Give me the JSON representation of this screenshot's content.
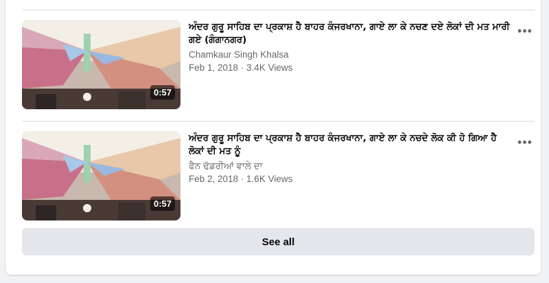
{
  "videos": [
    {
      "title": "ਅੰਦਰ ਗੁਰੂ ਸਾਹਿਬ ਦਾ ਪ੍ਰਕਾਸ਼ ਹੈ ਬਾਹਰ ਕੰਜਰਖਾਨਾ, ਗਾਏ ਲਾ ਕੇ ਨਚਣ ਦਏ ਲੋਕਾਂ ਦੀ ਮਤ ਮਾਰੀ ਗਏ (ਗੰਗਾਨਗਰ)",
      "channel": "Chamkaur Singh Khalsa",
      "stats": "Feb 1, 2018 · 3.4K Views",
      "duration": "0:57",
      "more_icon": "more-horizontal-icon"
    },
    {
      "title": "ਅੰਦਰ ਗੁਰੂ ਸਾਹਿਬ ਦਾ ਪ੍ਰਕਾਸ਼ ਹੈ ਬਾਹਰ ਕੰਜਰਖਾਨਾ, ਗਾਏ ਲਾ ਕੇ ਨਚਦੇ ਲੋਕ ਕੀ ਹੋ ਗਿਆ ਹੈ ਲੋਕਾਂ ਦੀ ਮਤ ਨੂੰ",
      "channel": "ਫੈਨ ਢੱਡਰੀਆਂ ਵਾਲੇ ਦਾ",
      "stats": "Feb 2, 2018 · 1.6K Views",
      "duration": "0:57",
      "more_icon": "more-horizontal-icon"
    }
  ],
  "see_all_label": "See all",
  "colors": {
    "card_bg": "#ffffff",
    "page_bg": "#f0f2f5",
    "secondary_text": "#65676b",
    "button_bg": "#e4e6eb"
  }
}
